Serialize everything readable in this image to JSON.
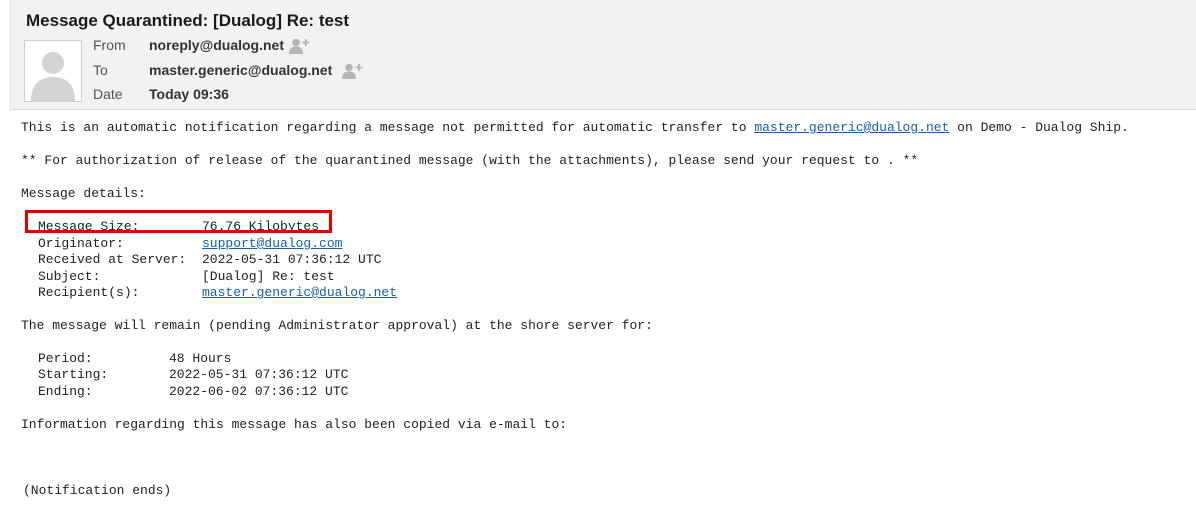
{
  "email": {
    "subject": "Message Quarantined: [Dualog] Re: test",
    "from_label": "From",
    "from_value": "noreply@dualog.net",
    "to_label": "To",
    "to_value": "master.generic@dualog.net",
    "date_label": "Date",
    "date_value": "Today 09:36"
  },
  "body": {
    "intro_pre": "This is an automatic notification regarding a message not permitted for automatic transfer to ",
    "intro_link": "master.generic@dualog.net",
    "intro_post": " on Demo - Dualog Ship.",
    "authorization": "** For authorization of release of the quarantined message (with the attachments), please send your request to . **",
    "details_heading": "Message details:",
    "details": {
      "size_label": "Message Size:",
      "size_value": "76.76 Kilobytes",
      "originator_label": "Originator:",
      "originator_value": "support@dualog.com",
      "received_label": "Received at Server:",
      "received_value": "2022-05-31 07:36:12 UTC",
      "subject_label": "Subject:",
      "subject_value": "[Dualog] Re: test",
      "recipients_label": "Recipient(s):",
      "recipients_value": "master.generic@dualog.net"
    },
    "remain_text": "The message will remain (pending Administrator approval) at the shore server for:",
    "period": {
      "period_label": "Period:",
      "period_value": "48 Hours",
      "starting_label": "Starting:",
      "starting_value": "2022-05-31 07:36:12 UTC",
      "ending_label": "Ending:",
      "ending_value": "2022-06-02 07:36:12 UTC"
    },
    "copied_text": "Information regarding this message has also been copied via e-mail to:",
    "ends_text": "(Notification ends)"
  },
  "colors": {
    "highlight": "#e00000",
    "link": "#1a5fa6",
    "header_bg": "#f2f2f2"
  },
  "icons": [
    "avatar-placeholder-icon",
    "add-contact-icon"
  ]
}
